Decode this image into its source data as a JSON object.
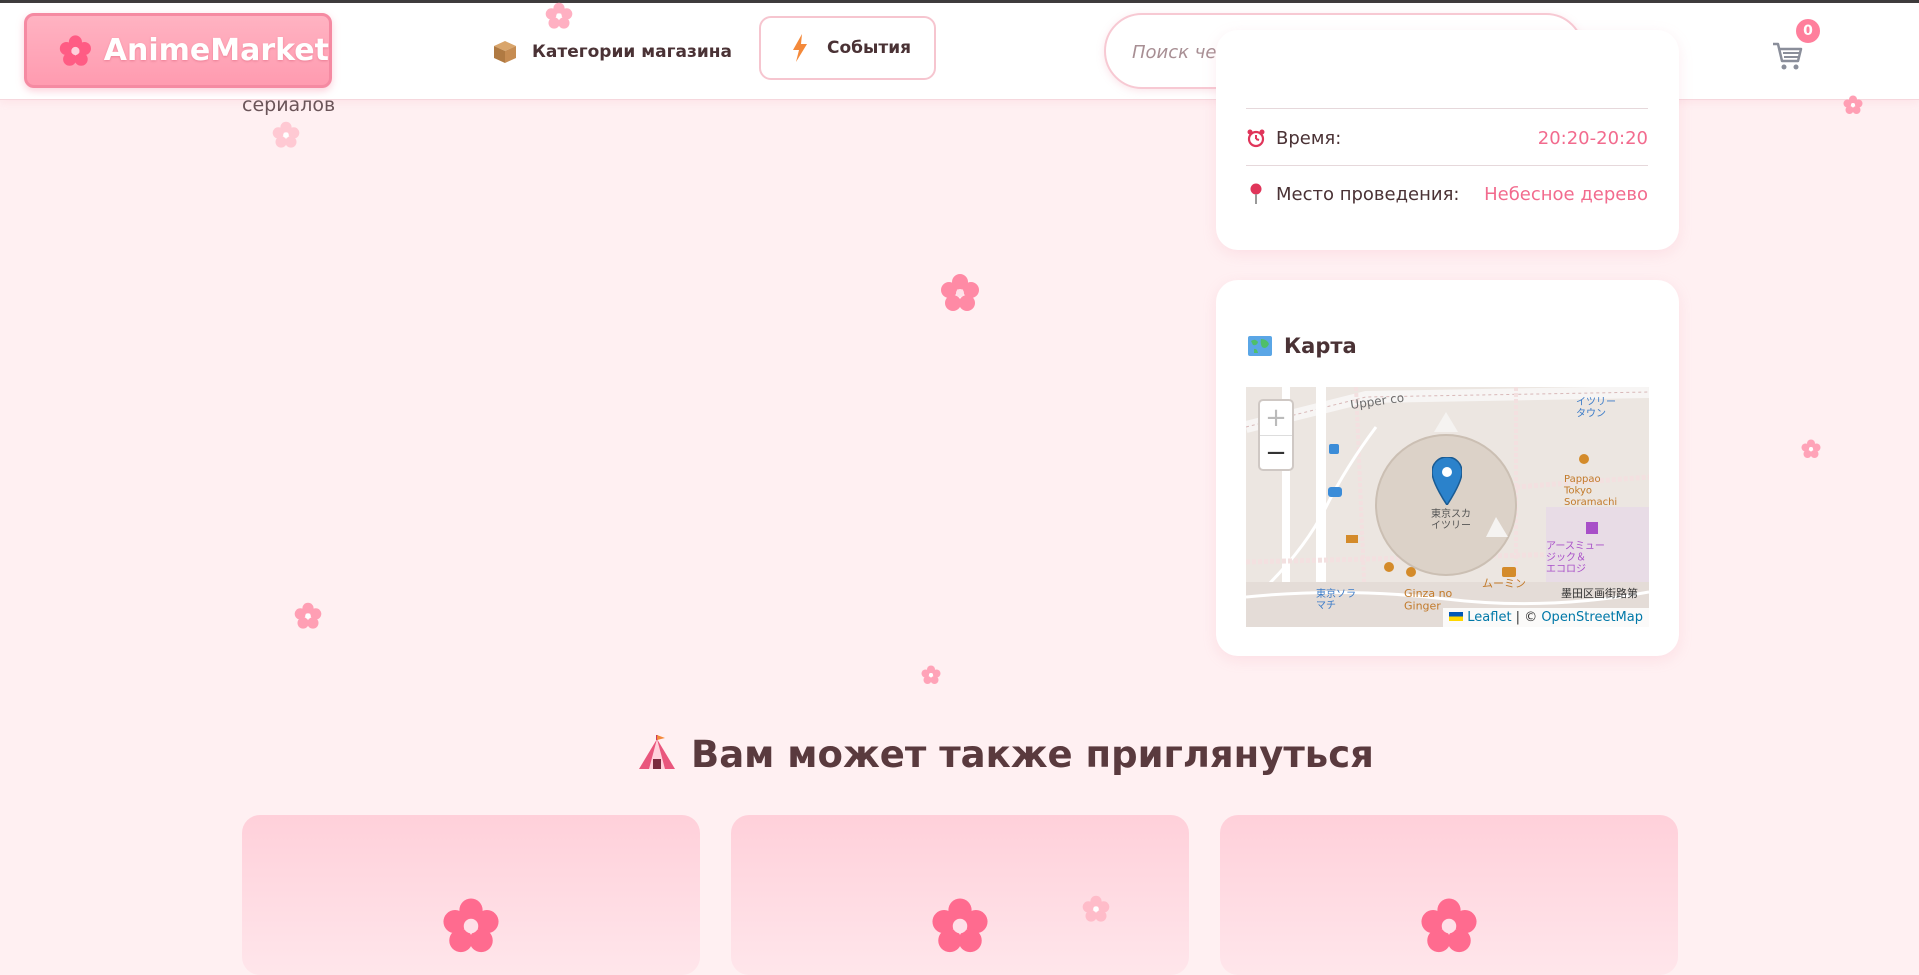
{
  "header": {
    "logo_text": "AnimeMarket",
    "nav": {
      "categories_label": "Категории магазина",
      "events_label": "События"
    },
    "search": {
      "placeholder": "Поиск чего-нибудь интересного..."
    },
    "cart_count": "0"
  },
  "left_fragment": "сериалов",
  "event_info": {
    "time_label": "Время:",
    "time_value": "20:20-20:20",
    "place_label": "Место проведения:",
    "place_value": "Небесное дерево"
  },
  "map": {
    "title": "Карта",
    "zoom_in": "+",
    "zoom_out": "−",
    "attribution": {
      "leaflet": "Leaflet",
      "separator": " | © ",
      "osm": "OpenStreetMap"
    },
    "labels": {
      "upper": "Upper co",
      "skytree": "東京スカ\nイツリー",
      "town": "イツリー\nタウン",
      "pappao": "Pappao\nTokyo\nSoramachi",
      "ginza": "Ginza no\nGinger",
      "sumida": "墨田区画街路第",
      "tokyo_sola": "東京ソラ\nマチ",
      "museum": "アースミュー\nジック＆\nエコロジ",
      "muumin": "ムーミン"
    }
  },
  "recommendations": {
    "title": "Вам может также приглянуться",
    "cards": [
      {},
      {},
      {}
    ]
  },
  "colors": {
    "accent": "#f26b8e",
    "background": "#fff0f2",
    "logo_bg": "#ff9bb0"
  }
}
